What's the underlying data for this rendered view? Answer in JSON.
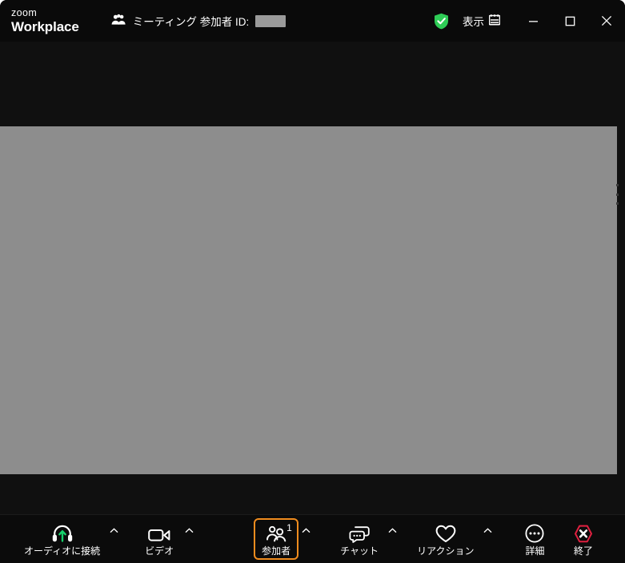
{
  "window": {
    "brand_zoom": "zoom",
    "brand_workplace": "Workplace",
    "meeting_id_label": "ミーティング 参加者 ID:",
    "meeting_id_value": "",
    "security_icon": "shield-check-icon",
    "view_label": "表示",
    "view_icon": "grid-view-icon",
    "minimize_label": "—",
    "maximize_label": "□",
    "close_label": "✕"
  },
  "colors": {
    "titlebar_bg": "#0a0a0a",
    "stage_bg": "#101010",
    "share_bg": "#8d8d8d",
    "toolbar_bg": "#0b0b0b",
    "focus_ring": "#f08c1e",
    "shield_green": "#2ecc56",
    "audio_arrow_green": "#16d06b",
    "end_red": "#e02040",
    "text": "#ffffff"
  },
  "toolbar": {
    "items": [
      {
        "name": "audio",
        "label": "オーディオに接続",
        "icon": "headphones-join-audio-icon",
        "has_caret": true,
        "caret_label": "^",
        "focused": false,
        "badge": ""
      },
      {
        "name": "video",
        "label": "ビデオ",
        "icon": "video-camera-icon",
        "has_caret": true,
        "caret_label": "^",
        "focused": false,
        "badge": ""
      },
      {
        "name": "participants",
        "label": "参加者",
        "icon": "participants-icon",
        "has_caret": true,
        "caret_label": "^",
        "focused": true,
        "badge": "1"
      },
      {
        "name": "chat",
        "label": "チャット",
        "icon": "chat-bubbles-icon",
        "has_caret": true,
        "caret_label": "^",
        "focused": false,
        "badge": ""
      },
      {
        "name": "reactions",
        "label": "リアクション",
        "icon": "heart-reactions-icon",
        "has_caret": true,
        "caret_label": "^",
        "focused": false,
        "badge": ""
      },
      {
        "name": "more",
        "label": "詳細",
        "icon": "more-ellipsis-icon",
        "has_caret": false,
        "caret_label": "",
        "focused": false,
        "badge": ""
      }
    ],
    "end_button": {
      "label": "終了",
      "icon": "end-meeting-hexagon-x-icon"
    }
  }
}
